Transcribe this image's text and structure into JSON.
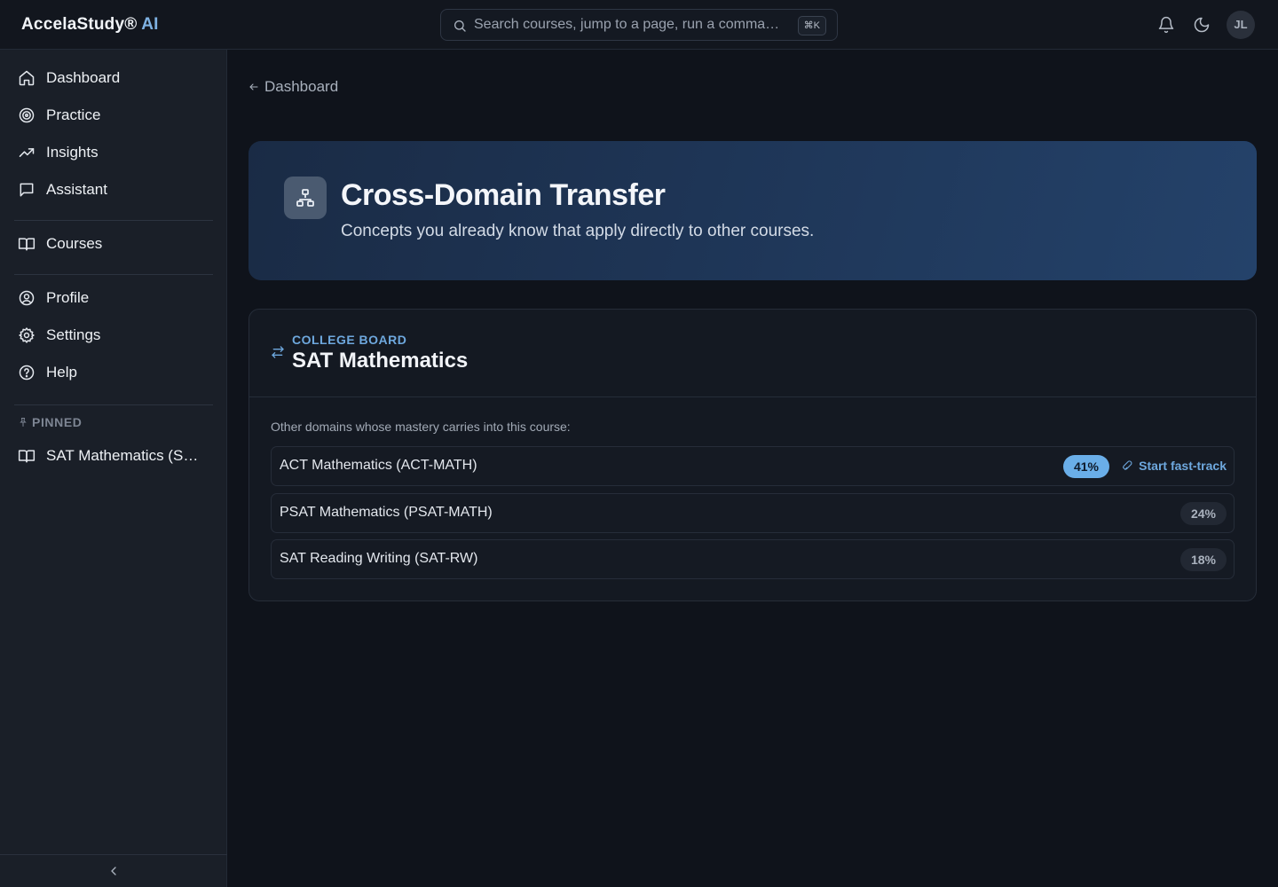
{
  "brand": {
    "name": "AccelaStudy®",
    "suffix": " AI"
  },
  "search": {
    "placeholder": "Search courses, jump to a page, run a comma…",
    "shortcut": "⌘K"
  },
  "user": {
    "initials": "JL"
  },
  "sidebar": {
    "items": [
      {
        "label": "Dashboard",
        "icon": "home-icon"
      },
      {
        "label": "Practice",
        "icon": "target-icon"
      },
      {
        "label": "Insights",
        "icon": "trending-up-icon"
      },
      {
        "label": "Assistant",
        "icon": "chat-icon"
      },
      {
        "label": "Courses",
        "icon": "book-icon"
      },
      {
        "label": "Profile",
        "icon": "user-circle-icon"
      },
      {
        "label": "Settings",
        "icon": "gear-icon"
      },
      {
        "label": "Help",
        "icon": "help-icon"
      }
    ],
    "pinned_label": "PINNED",
    "pinned_items": [
      {
        "label": "SAT Mathematics (SAT-MATH)",
        "icon": "book-icon"
      }
    ]
  },
  "breadcrumb": {
    "back_label": "Dashboard"
  },
  "hero": {
    "title": "Cross-Domain Transfer",
    "subtitle": "Concepts you already know that apply directly to other courses.",
    "icon": "network-icon"
  },
  "card": {
    "eyebrow": "COLLEGE BOARD",
    "title": "SAT Mathematics",
    "intro": "Other domains whose mastery carries into this course:",
    "rows": [
      {
        "name": "ACT Mathematics (ACT-MATH)",
        "percent": "41%",
        "action": "Start fast-track"
      },
      {
        "name": "PSAT Mathematics (PSAT-MATH)",
        "percent": "24%"
      },
      {
        "name": "SAT Reading Writing (SAT-RW)",
        "percent": "18%"
      }
    ]
  },
  "colors": {
    "accent": "#6aaee8",
    "background": "#0f131b",
    "sidebar": "#1a1f28"
  }
}
